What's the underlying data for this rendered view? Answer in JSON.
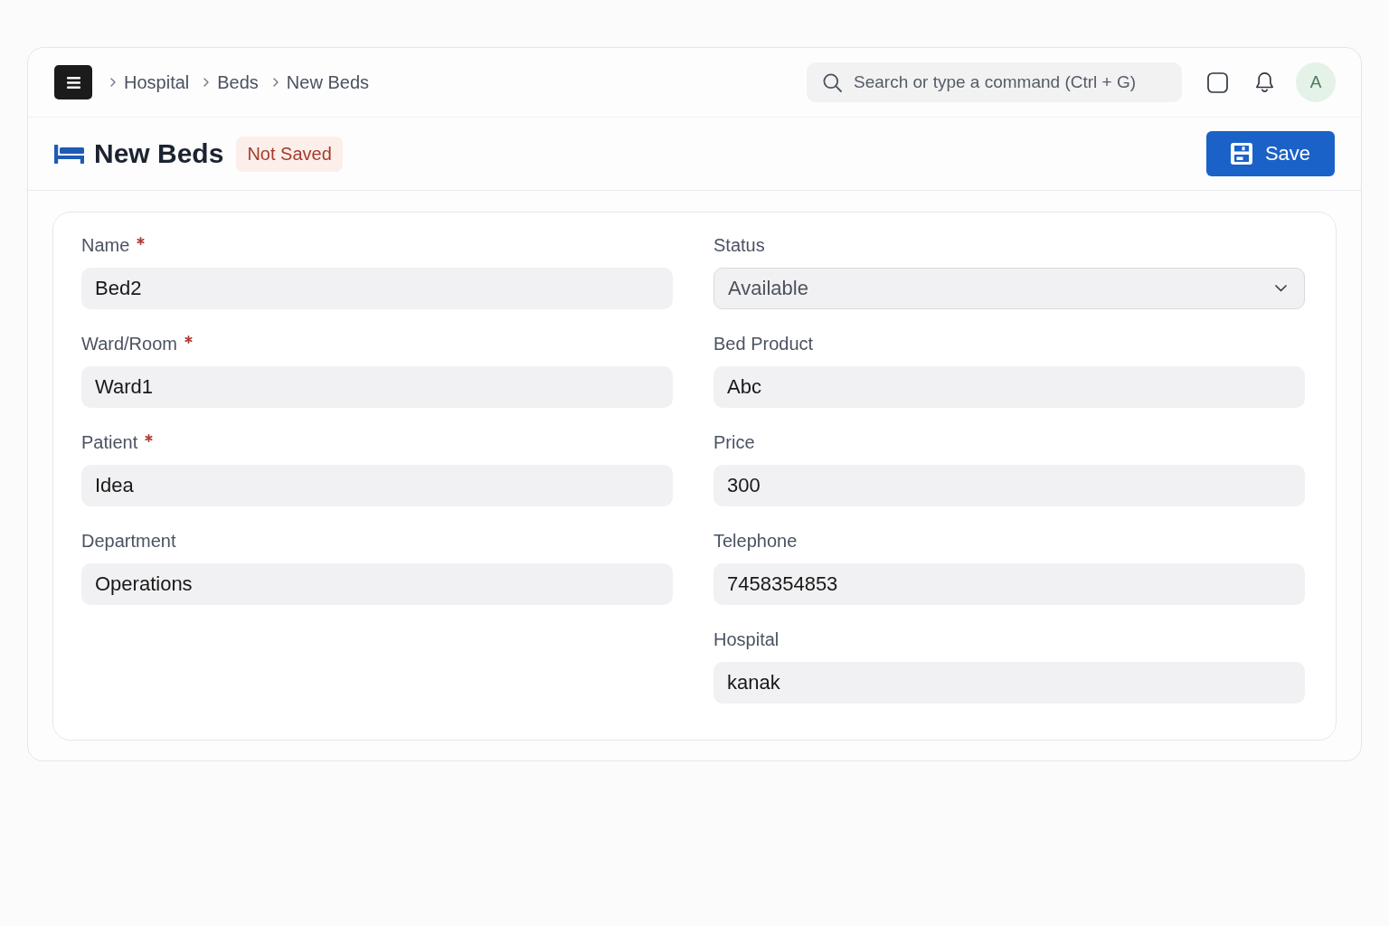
{
  "topbar": {
    "breadcrumbs": [
      {
        "label": "Hospital"
      },
      {
        "label": "Beds"
      },
      {
        "label": "New Beds"
      }
    ],
    "search": {
      "placeholder": "Search or type a command (Ctrl + G)"
    },
    "avatar": {
      "initial": "A"
    }
  },
  "page_header": {
    "title": "New Beds",
    "badge": "Not Saved",
    "save_button": {
      "label": "Save"
    }
  },
  "form": {
    "columns": [
      {
        "fields": [
          {
            "label": "Name",
            "required": true,
            "kind": "text",
            "value": "Bed2"
          },
          {
            "label": "Ward/Room",
            "required": true,
            "kind": "text",
            "value": "Ward1"
          },
          {
            "label": "Patient",
            "required": true,
            "kind": "text",
            "value": "Idea"
          },
          {
            "label": "Department",
            "required": false,
            "kind": "text",
            "value": "Operations"
          }
        ]
      },
      {
        "fields": [
          {
            "label": "Status",
            "required": false,
            "kind": "select",
            "value": "Available"
          },
          {
            "label": "Bed Product",
            "required": false,
            "kind": "text",
            "value": "Abc"
          },
          {
            "label": "Price",
            "required": false,
            "kind": "text",
            "value": "300"
          },
          {
            "label": "Telephone",
            "required": false,
            "kind": "text",
            "value": "7458354853"
          },
          {
            "label": "Hospital",
            "required": false,
            "kind": "text",
            "value": "kanak"
          }
        ]
      }
    ]
  }
}
